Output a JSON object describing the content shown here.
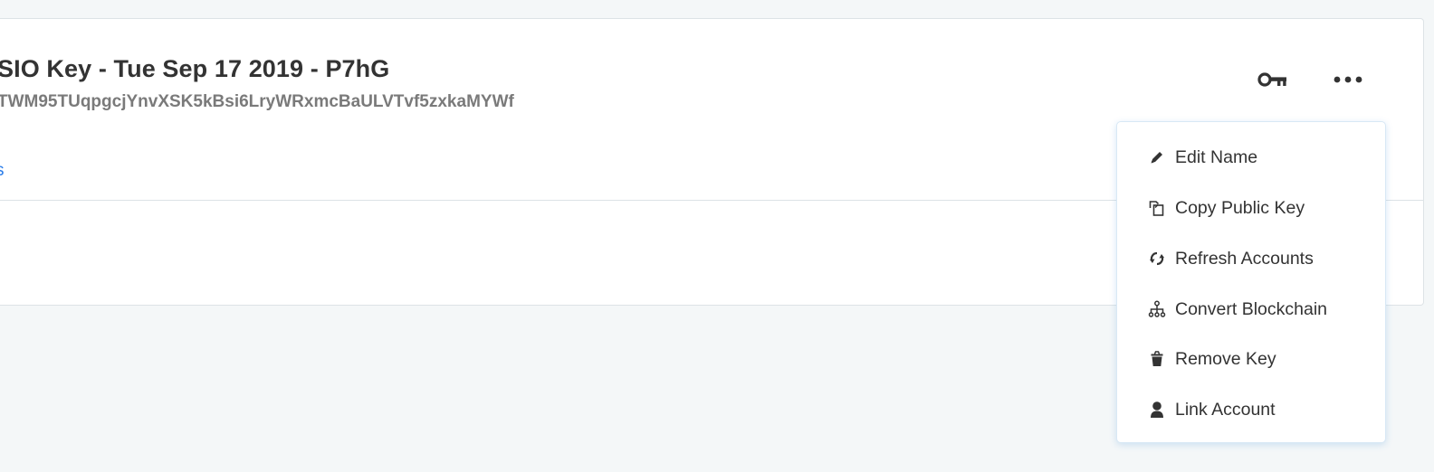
{
  "key": {
    "title": "SIO Key - Tue Sep 17 2019 - P7hG",
    "public_key": "TWM95TUqpgcjYnvXSK5kBsi6LryWRxmcBaULVTvf5zxkaMYWf",
    "link_text": "s"
  },
  "actions": {
    "key_icon": "key-icon",
    "more_icon": "ellipsis-icon"
  },
  "menu": {
    "items": [
      {
        "label": "Edit Name",
        "icon": "pencil-icon"
      },
      {
        "label": "Copy Public Key",
        "icon": "copy-icon"
      },
      {
        "label": "Refresh Accounts",
        "icon": "refresh-icon"
      },
      {
        "label": "Convert Blockchain",
        "icon": "hierarchy-icon"
      },
      {
        "label": "Remove Key",
        "icon": "trash-icon"
      },
      {
        "label": "Link Account",
        "icon": "user-icon"
      }
    ]
  },
  "colors": {
    "background": "#f4f7f8",
    "link": "#2b7de9",
    "text": "#333333",
    "muted": "#7a7a7a"
  }
}
